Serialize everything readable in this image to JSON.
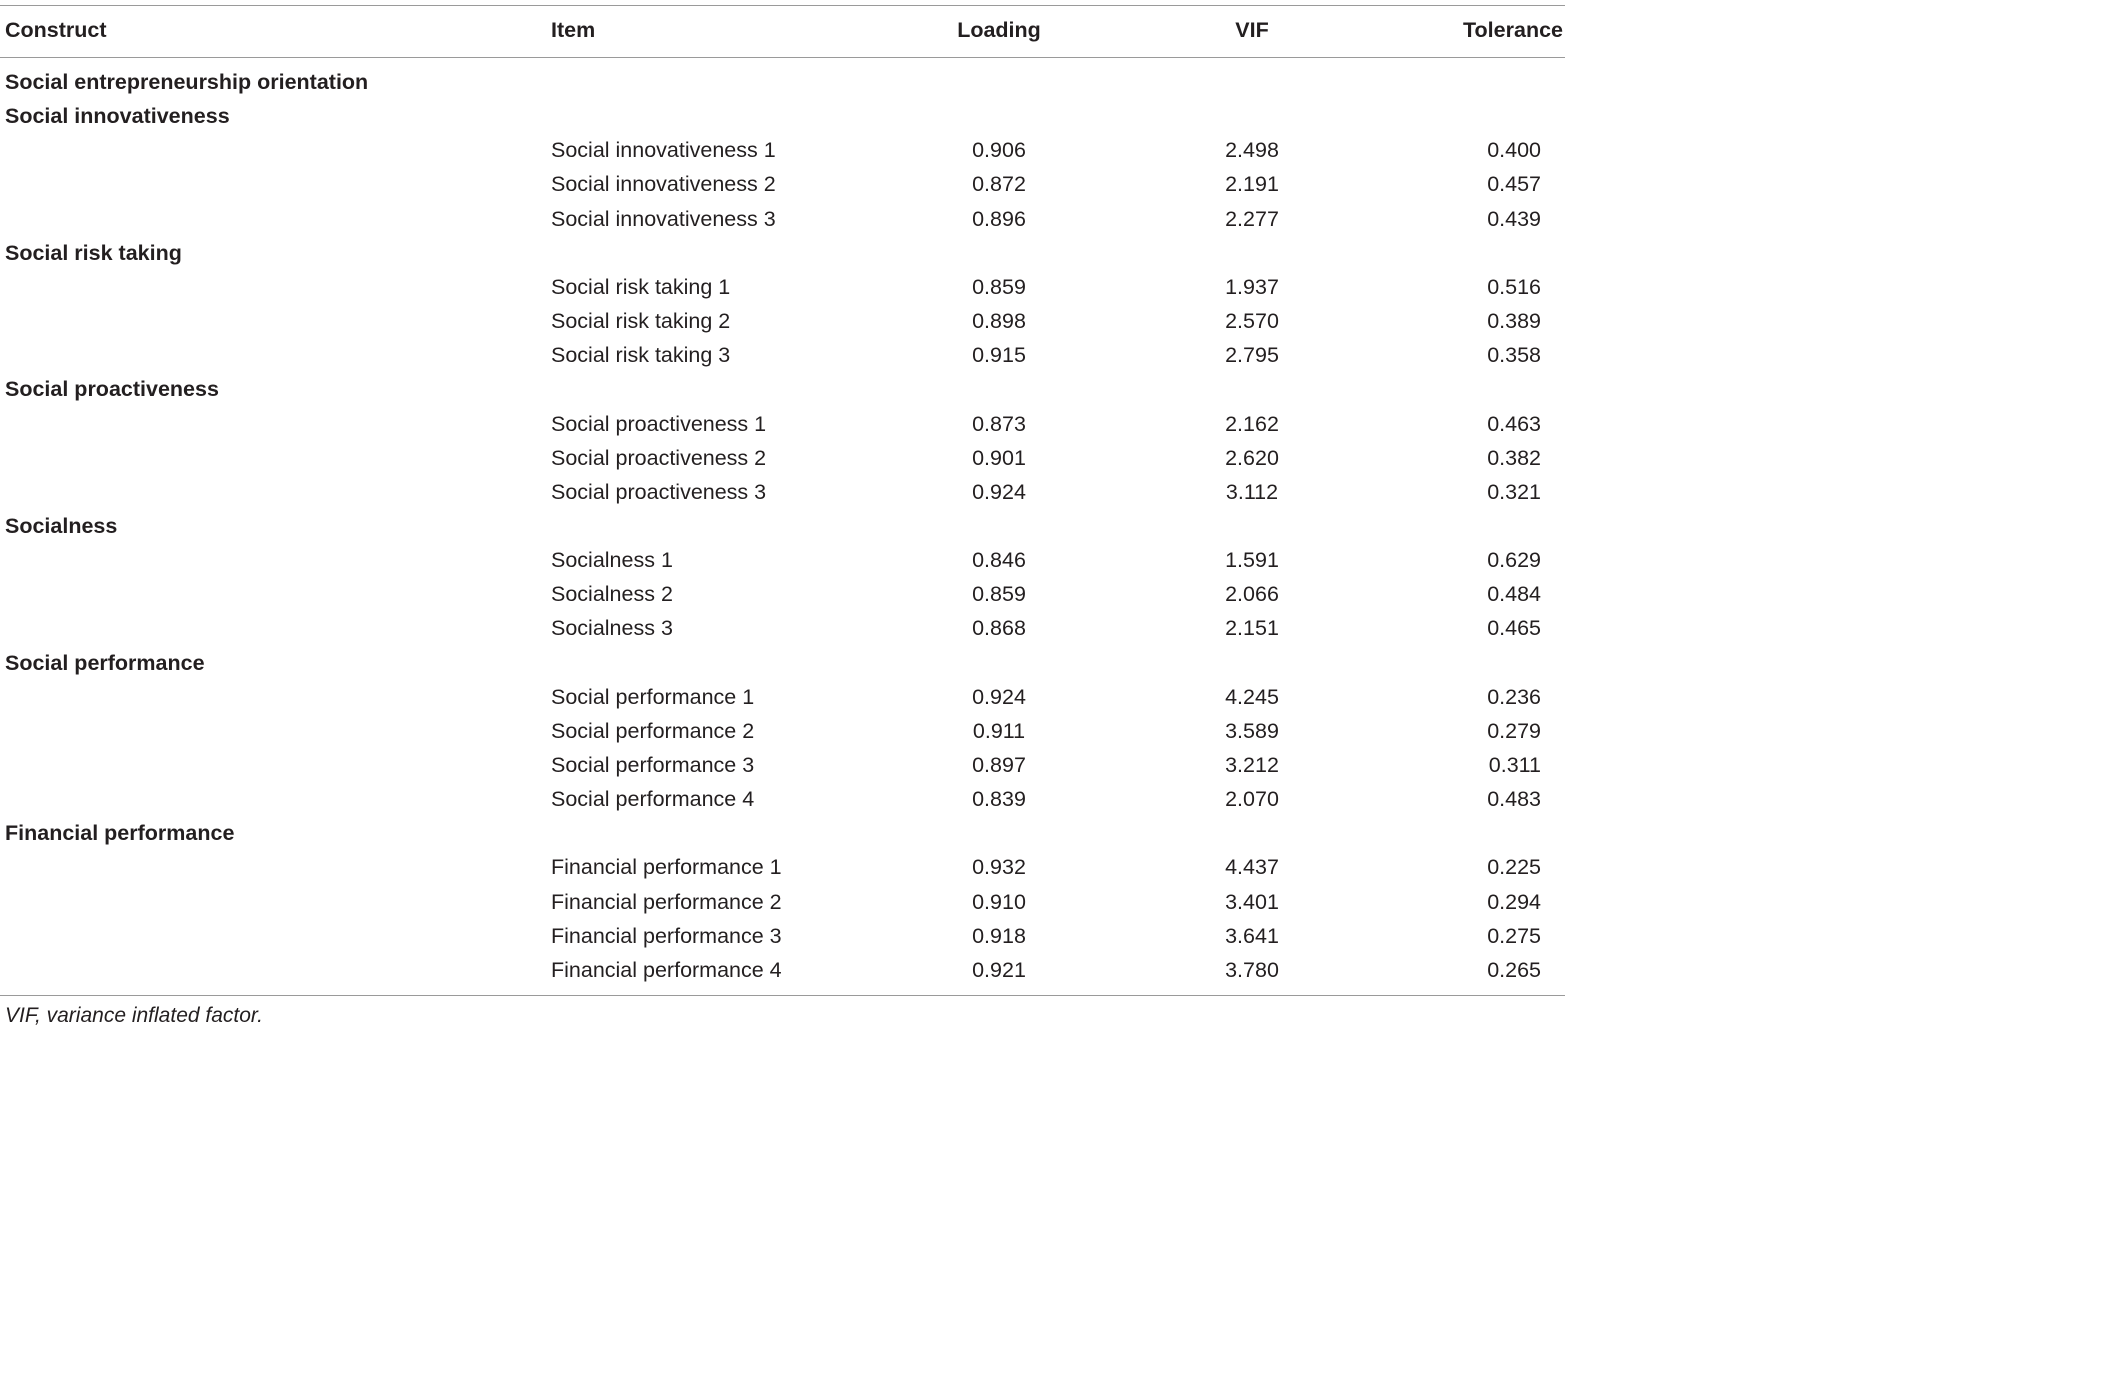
{
  "header": {
    "construct": "Construct",
    "item": "Item",
    "loading": "Loading",
    "vif": "VIF",
    "tolerance": "Tolerance"
  },
  "sections": [
    {
      "title": "Social entrepreneurship orientation",
      "rows": []
    },
    {
      "title": "Social innovativeness",
      "rows": [
        {
          "item": "Social innovativeness 1",
          "loading": "0.906",
          "vif": "2.498",
          "tolerance": "0.400"
        },
        {
          "item": "Social innovativeness 2",
          "loading": "0.872",
          "vif": "2.191",
          "tolerance": "0.457"
        },
        {
          "item": "Social innovativeness 3",
          "loading": "0.896",
          "vif": "2.277",
          "tolerance": "0.439"
        }
      ]
    },
    {
      "title": "Social risk taking",
      "rows": [
        {
          "item": "Social risk taking 1",
          "loading": "0.859",
          "vif": "1.937",
          "tolerance": "0.516"
        },
        {
          "item": "Social risk taking 2",
          "loading": "0.898",
          "vif": "2.570",
          "tolerance": "0.389"
        },
        {
          "item": "Social risk taking 3",
          "loading": "0.915",
          "vif": "2.795",
          "tolerance": "0.358"
        }
      ]
    },
    {
      "title": "Social proactiveness",
      "rows": [
        {
          "item": "Social proactiveness 1",
          "loading": "0.873",
          "vif": "2.162",
          "tolerance": "0.463"
        },
        {
          "item": "Social proactiveness 2",
          "loading": "0.901",
          "vif": "2.620",
          "tolerance": "0.382"
        },
        {
          "item": "Social proactiveness 3",
          "loading": "0.924",
          "vif": "3.112",
          "tolerance": "0.321"
        }
      ]
    },
    {
      "title": "Socialness",
      "rows": [
        {
          "item": "Socialness 1",
          "loading": "0.846",
          "vif": "1.591",
          "tolerance": "0.629"
        },
        {
          "item": "Socialness 2",
          "loading": "0.859",
          "vif": "2.066",
          "tolerance": "0.484"
        },
        {
          "item": "Socialness 3",
          "loading": "0.868",
          "vif": "2.151",
          "tolerance": "0.465"
        }
      ]
    },
    {
      "title": "Social performance",
      "rows": [
        {
          "item": "Social performance 1",
          "loading": "0.924",
          "vif": "4.245",
          "tolerance": "0.236"
        },
        {
          "item": "Social performance 2",
          "loading": "0.911",
          "vif": "3.589",
          "tolerance": "0.279"
        },
        {
          "item": "Social performance 3",
          "loading": "0.897",
          "vif": "3.212",
          "tolerance": "0.311"
        },
        {
          "item": "Social performance 4",
          "loading": "0.839",
          "vif": "2.070",
          "tolerance": "0.483"
        }
      ]
    },
    {
      "title": "Financial performance",
      "rows": [
        {
          "item": "Financial performance 1",
          "loading": "0.932",
          "vif": "4.437",
          "tolerance": "0.225"
        },
        {
          "item": "Financial performance 2",
          "loading": "0.910",
          "vif": "3.401",
          "tolerance": "0.294"
        },
        {
          "item": "Financial performance 3",
          "loading": "0.918",
          "vif": "3.641",
          "tolerance": "0.275"
        },
        {
          "item": "Financial performance 4",
          "loading": "0.921",
          "vif": "3.780",
          "tolerance": "0.265"
        }
      ]
    }
  ],
  "footnote": "VIF, variance inflated factor."
}
